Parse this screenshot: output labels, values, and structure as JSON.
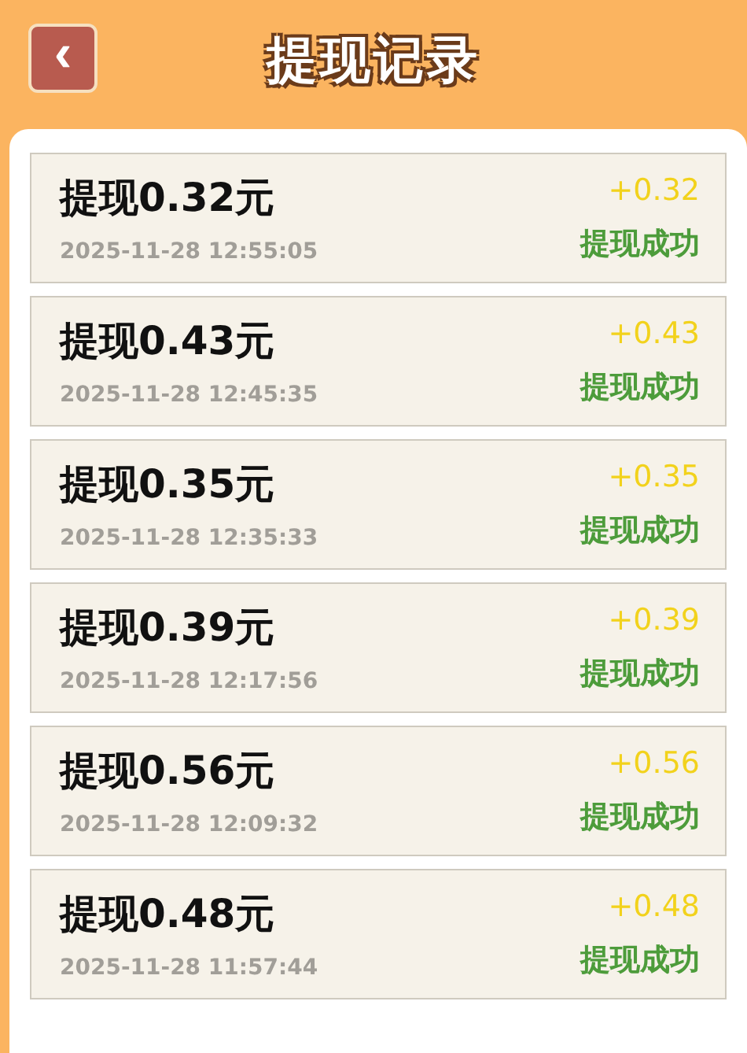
{
  "header": {
    "title": "提现记录",
    "back_icon": "‹"
  },
  "records": [
    {
      "title": "提现0.32元",
      "time": "2025-11-28 12:55:05",
      "amount": "+0.32",
      "status": "提现成功"
    },
    {
      "title": "提现0.43元",
      "time": "2025-11-28 12:45:35",
      "amount": "+0.43",
      "status": "提现成功"
    },
    {
      "title": "提现0.35元",
      "time": "2025-11-28 12:35:33",
      "amount": "+0.35",
      "status": "提现成功"
    },
    {
      "title": "提现0.39元",
      "time": "2025-11-28 12:17:56",
      "amount": "+0.39",
      "status": "提现成功"
    },
    {
      "title": "提现0.56元",
      "time": "2025-11-28 12:09:32",
      "amount": "+0.56",
      "status": "提现成功"
    },
    {
      "title": "提现0.48元",
      "time": "2025-11-28 11:57:44",
      "amount": "+0.48",
      "status": "提现成功"
    }
  ]
}
